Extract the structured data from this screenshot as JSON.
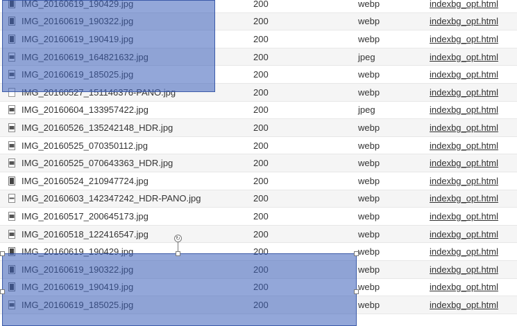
{
  "rows": [
    {
      "name": "IMG_20160619_190429.jpg",
      "status": "200",
      "type": "webp",
      "initiator": "indexbg_opt.html",
      "icon": "image-file-icon"
    },
    {
      "name": "IMG_20160619_190322.jpg",
      "status": "200",
      "type": "webp",
      "initiator": "indexbg_opt.html",
      "icon": "image-file-icon"
    },
    {
      "name": "IMG_20160619_190419.jpg",
      "status": "200",
      "type": "webp",
      "initiator": "indexbg_opt.html",
      "icon": "image-file-icon"
    },
    {
      "name": "IMG_20160619_164821632.jpg",
      "status": "200",
      "type": "jpeg",
      "initiator": "indexbg_opt.html",
      "icon": "landscape-image-icon"
    },
    {
      "name": "IMG_20160619_185025.jpg",
      "status": "200",
      "type": "webp",
      "initiator": "indexbg_opt.html",
      "icon": "landscape-image-icon"
    },
    {
      "name": "IMG_20160527_151146376-PANO.jpg",
      "status": "200",
      "type": "webp",
      "initiator": "indexbg_opt.html",
      "icon": "blank-file-icon"
    },
    {
      "name": "IMG_20160604_133957422.jpg",
      "status": "200",
      "type": "jpeg",
      "initiator": "indexbg_opt.html",
      "icon": "landscape-image-icon"
    },
    {
      "name": "IMG_20160526_135242148_HDR.jpg",
      "status": "200",
      "type": "webp",
      "initiator": "indexbg_opt.html",
      "icon": "landscape-image-icon"
    },
    {
      "name": "IMG_20160525_070350112.jpg",
      "status": "200",
      "type": "webp",
      "initiator": "indexbg_opt.html",
      "icon": "landscape-image-icon"
    },
    {
      "name": "IMG_20160525_070643363_HDR.jpg",
      "status": "200",
      "type": "webp",
      "initiator": "indexbg_opt.html",
      "icon": "landscape-image-icon"
    },
    {
      "name": "IMG_20160524_210947724.jpg",
      "status": "200",
      "type": "webp",
      "initiator": "indexbg_opt.html",
      "icon": "image-file-icon"
    },
    {
      "name": "IMG_20160603_142347242_HDR-PANO.jpg",
      "status": "200",
      "type": "webp",
      "initiator": "indexbg_opt.html",
      "icon": "panorama-image-icon"
    },
    {
      "name": "IMG_20160517_200645173.jpg",
      "status": "200",
      "type": "webp",
      "initiator": "indexbg_opt.html",
      "icon": "landscape-image-icon"
    },
    {
      "name": "IMG_20160518_122416547.jpg",
      "status": "200",
      "type": "webp",
      "initiator": "indexbg_opt.html",
      "icon": "landscape-image-icon"
    },
    {
      "name": "IMG_20160619_190429.jpg",
      "status": "200",
      "type": "webp",
      "initiator": "indexbg_opt.html",
      "icon": "image-file-icon"
    },
    {
      "name": "IMG_20160619_190322.jpg",
      "status": "200",
      "type": "webp",
      "initiator": "indexbg_opt.html",
      "icon": "image-file-icon"
    },
    {
      "name": "IMG_20160619_190419.jpg",
      "status": "200",
      "type": "webp",
      "initiator": "indexbg_opt.html",
      "icon": "image-file-icon"
    },
    {
      "name": "IMG_20160619_185025.jpg",
      "status": "200",
      "type": "webp",
      "initiator": "indexbg_opt.html",
      "icon": "landscape-image-icon"
    }
  ],
  "selection": {
    "top_rows": [
      0,
      1,
      2,
      3,
      4
    ],
    "bottom_rows": [
      14,
      15,
      16,
      17
    ]
  },
  "colors": {
    "selection_fill": "#3a5fb9",
    "row_alt": "#f5f5f5",
    "row_bg": "#ffffff",
    "text": "#333333"
  }
}
